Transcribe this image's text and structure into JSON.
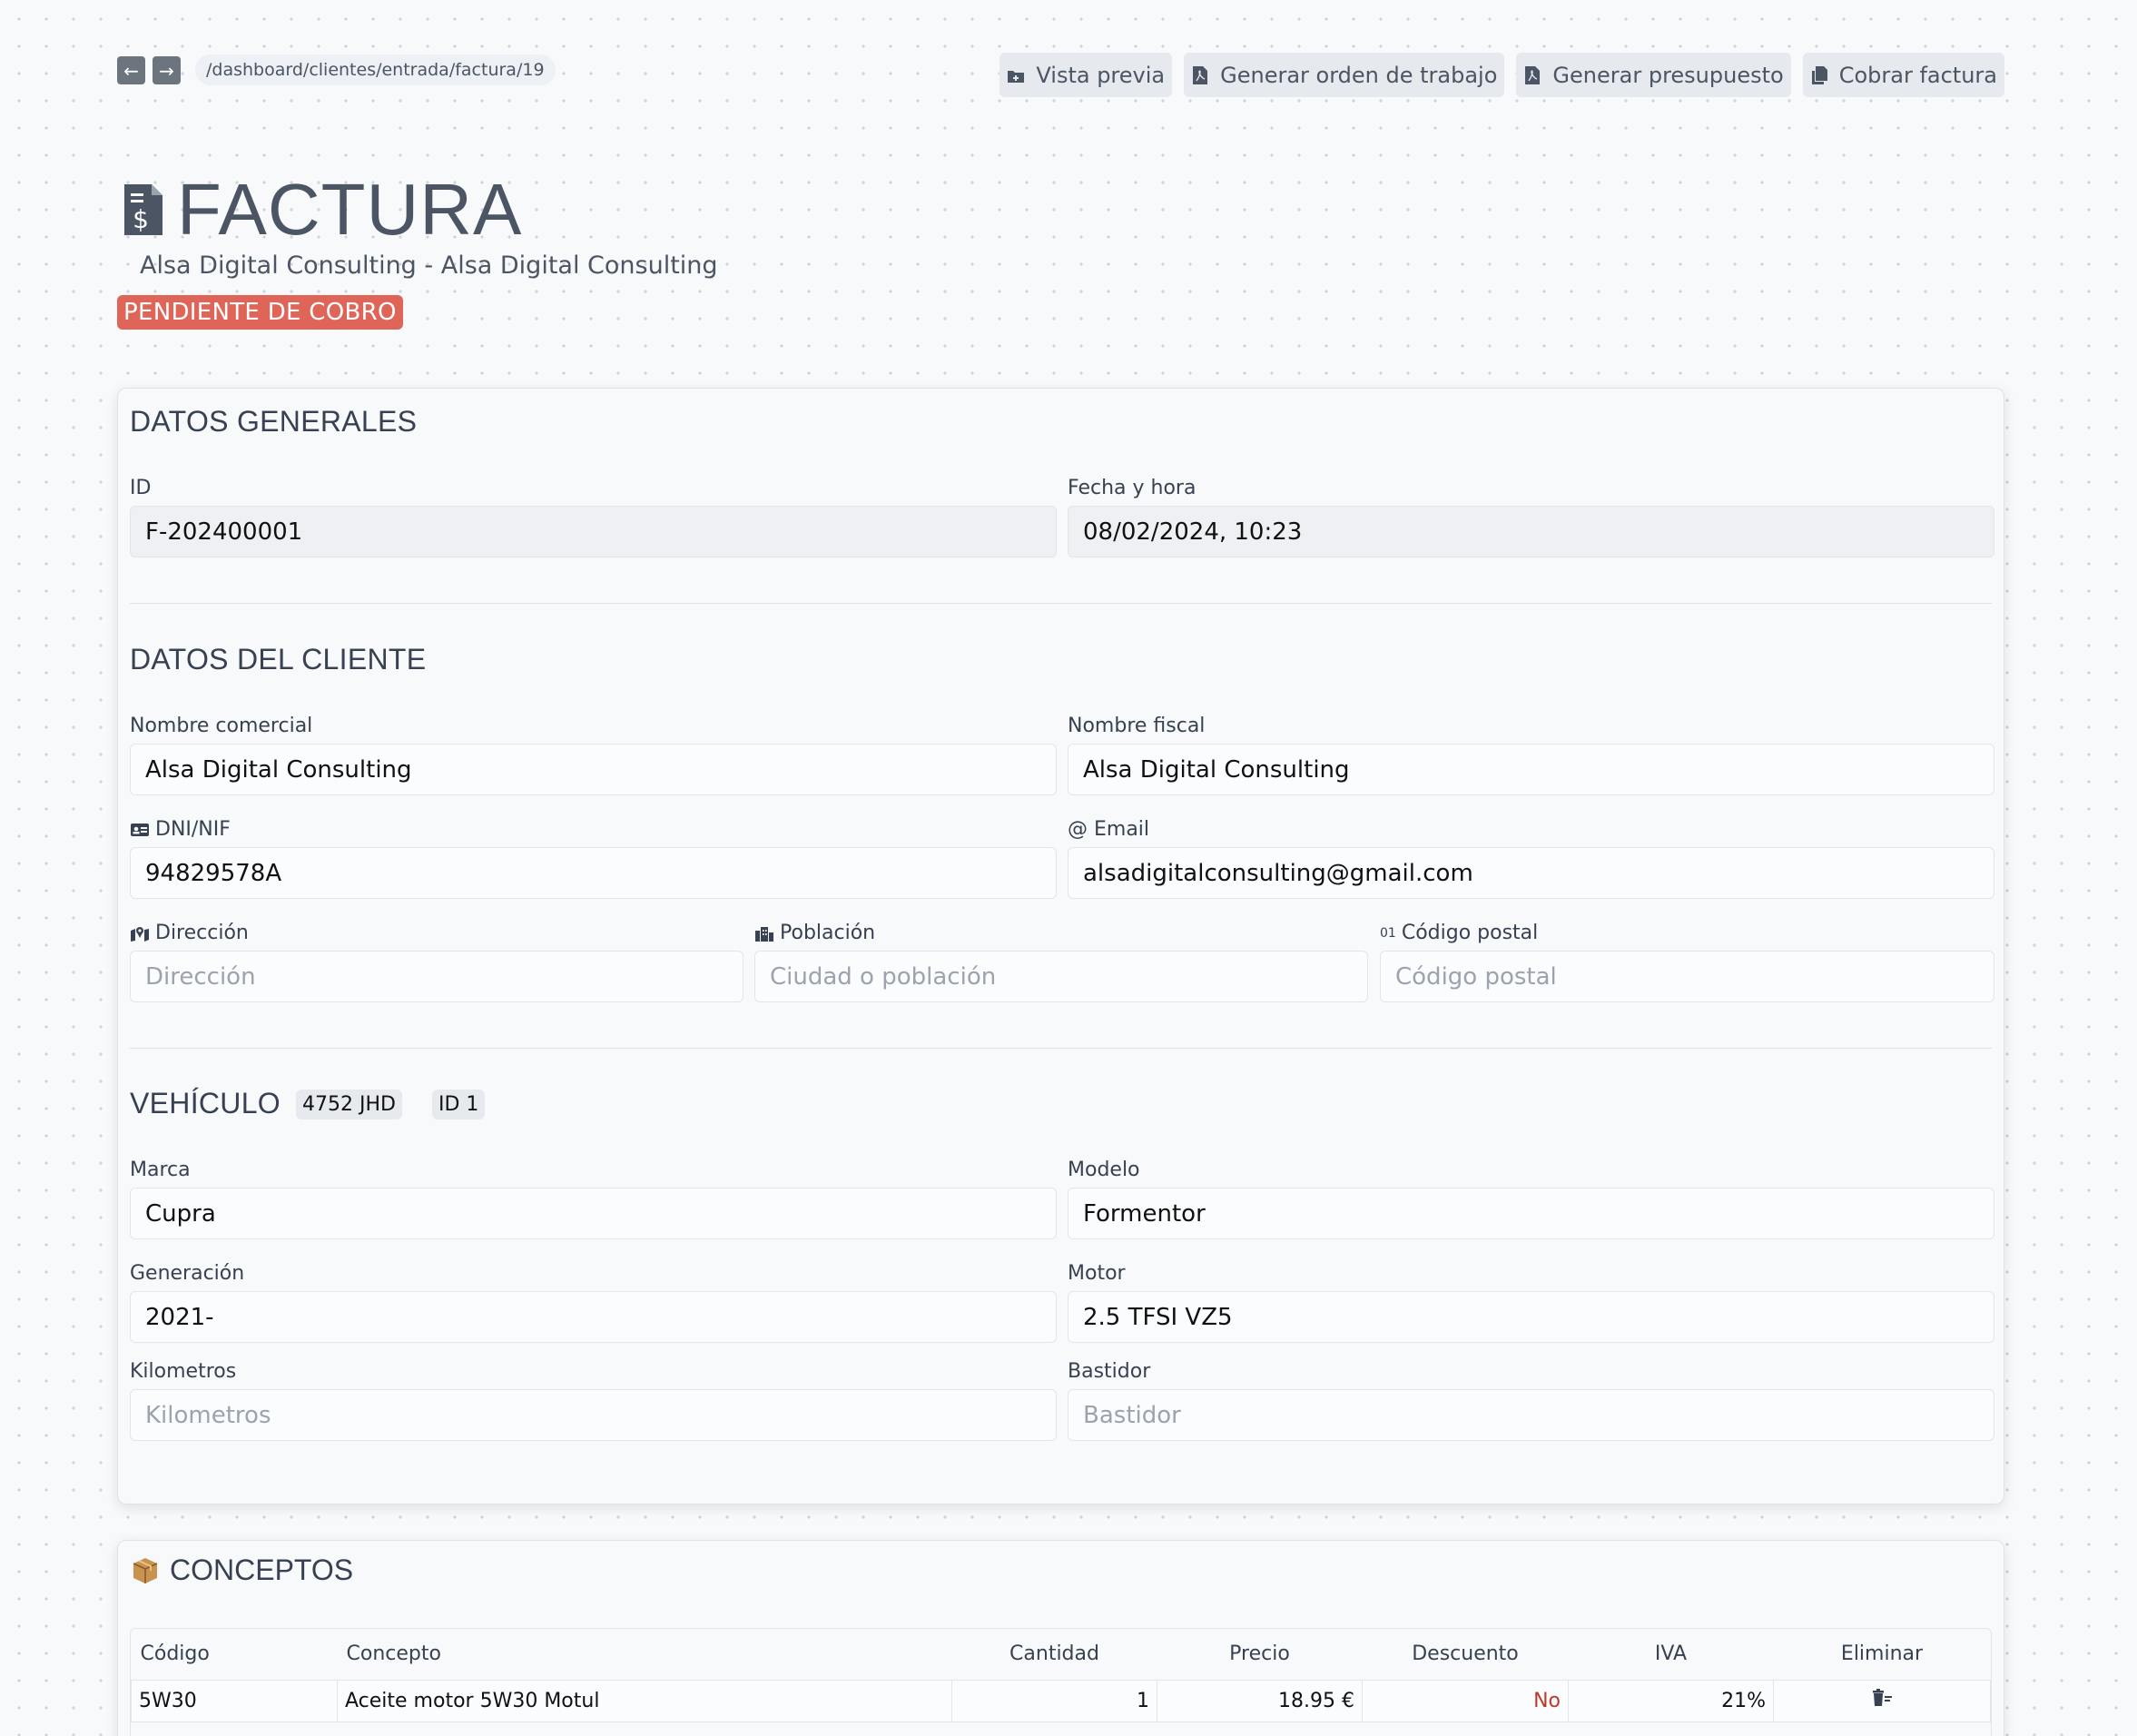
{
  "breadcrumb": "/dashboard/clientes/entrada/factura/19",
  "actions": {
    "preview": "Vista previa",
    "work_order": "Generar orden de trabajo",
    "budget": "Generar presupuesto",
    "charge": "Cobrar factura"
  },
  "header": {
    "title": "FACTURA",
    "subtitle": "Alsa Digital Consulting - Alsa Digital Consulting",
    "status": "PENDIENTE DE COBRO",
    "status_color": "#e06559"
  },
  "general": {
    "title": "DATOS GENERALES",
    "id_label": "ID",
    "id_value": "F-202400001",
    "date_label": "Fecha y hora",
    "date_value": "08/02/2024, 10:23"
  },
  "client": {
    "title": "DATOS DEL CLIENTE",
    "trade_name_label": "Nombre comercial",
    "trade_name_value": "Alsa Digital Consulting",
    "fiscal_name_label": "Nombre fiscal",
    "fiscal_name_value": "Alsa Digital Consulting",
    "dni_label": "DNI/NIF",
    "dni_value": "94829578A",
    "email_label": "@ Email",
    "email_value": "alsadigitalconsulting@gmail.com",
    "address_label": "Dirección",
    "address_placeholder": "Dirección",
    "city_label": "Población",
    "city_placeholder": "Ciudad o población",
    "postal_prefix": "01",
    "postal_label": "Código postal",
    "postal_placeholder": "Código postal"
  },
  "vehicle": {
    "title": "VEHÍCULO",
    "plate": "4752 JHD",
    "id_badge": "ID 1",
    "brand_label": "Marca",
    "brand_value": "Cupra",
    "model_label": "Modelo",
    "model_value": "Formentor",
    "generation_label": "Generación",
    "generation_value": "2021-",
    "engine_label": "Motor",
    "engine_value": "2.5 TFSI VZ5",
    "km_label": "Kilometros",
    "km_placeholder": "Kilometros",
    "chassis_label": "Bastidor",
    "chassis_placeholder": "Bastidor"
  },
  "concepts": {
    "title": "CONCEPTOS",
    "columns": [
      "Código",
      "Concepto",
      "Cantidad",
      "Precio",
      "Descuento",
      "IVA",
      "Eliminar"
    ],
    "rows": [
      {
        "code": "5W30",
        "concept": "Aceite motor 5W30 Motul",
        "qty": "1",
        "price": "18.95 €",
        "discount": "No",
        "vat": "21%"
      }
    ]
  },
  "colors": {
    "discount_no": "#c0392b",
    "button_bg": "#e6e9ee",
    "text_muted": "#4b5563"
  }
}
